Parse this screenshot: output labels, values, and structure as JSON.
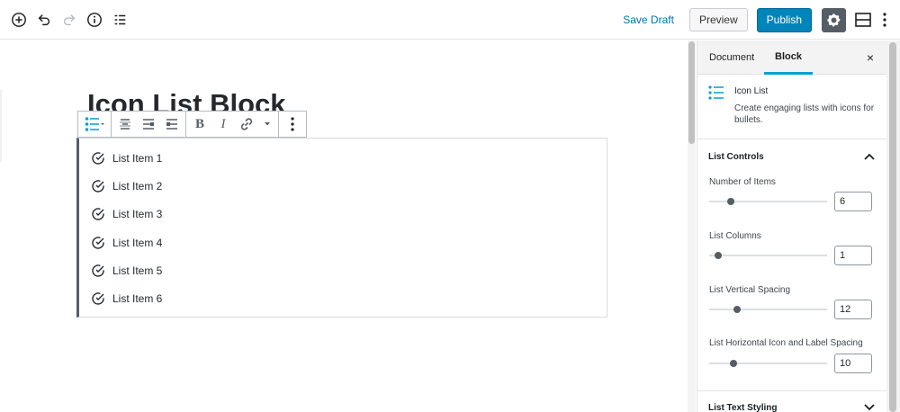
{
  "topbar": {
    "left_icons": [
      "add-block-icon",
      "undo-icon",
      "redo-icon",
      "info-icon",
      "outline-icon"
    ],
    "save_draft": "Save Draft",
    "preview": "Preview",
    "publish": "Publish",
    "right_icons": [
      "gear-icon",
      "layout-icon",
      "more-vertical-icon"
    ]
  },
  "editor": {
    "title": "Icon List Block",
    "block_toolbar": {
      "groups": [
        [
          "list-icon-switcher"
        ],
        [
          "align-center-icon",
          "align-left-icon",
          "align-right-icon"
        ],
        [
          "bold",
          "italic",
          "link",
          "more-dropdown"
        ],
        [
          "more-options-icon"
        ]
      ],
      "bold_label": "B",
      "italic_label": "I"
    },
    "list_items": [
      {
        "label": "List Item 1",
        "icon": "check-circle-icon"
      },
      {
        "label": "List Item 2",
        "icon": "check-circle-icon"
      },
      {
        "label": "List Item 3",
        "icon": "check-circle-icon"
      },
      {
        "label": "List Item 4",
        "icon": "check-circle-icon"
      },
      {
        "label": "List Item 5",
        "icon": "check-circle-icon"
      },
      {
        "label": "List Item 6",
        "icon": "check-circle-icon"
      }
    ]
  },
  "sidebar": {
    "tabs": [
      {
        "label": "Document"
      },
      {
        "label": "Block"
      }
    ],
    "active_tab": "Block",
    "close_label": "×",
    "block_card": {
      "name": "Icon List",
      "description": "Create engaging lists with icons for bullets."
    },
    "panels": {
      "list_controls": {
        "title": "List Controls",
        "expanded": true,
        "controls": [
          {
            "label": "Number of Items",
            "value": "6",
            "fraction": 0.16
          },
          {
            "label": "List Columns",
            "value": "1",
            "fraction": 0.05
          },
          {
            "label": "List Vertical Spacing",
            "value": "12",
            "fraction": 0.22
          },
          {
            "label": "List Horizontal Icon and Label Spacing",
            "value": "10",
            "fraction": 0.19
          }
        ]
      },
      "list_text_styling": {
        "title": "List Text Styling",
        "expanded": false
      }
    }
  },
  "colors": {
    "accent": "#0085ba",
    "link": "#0073aa",
    "tab_active": "#00a0d2",
    "icon_teal": "#00a0d2",
    "settings_bg": "#555d66"
  }
}
